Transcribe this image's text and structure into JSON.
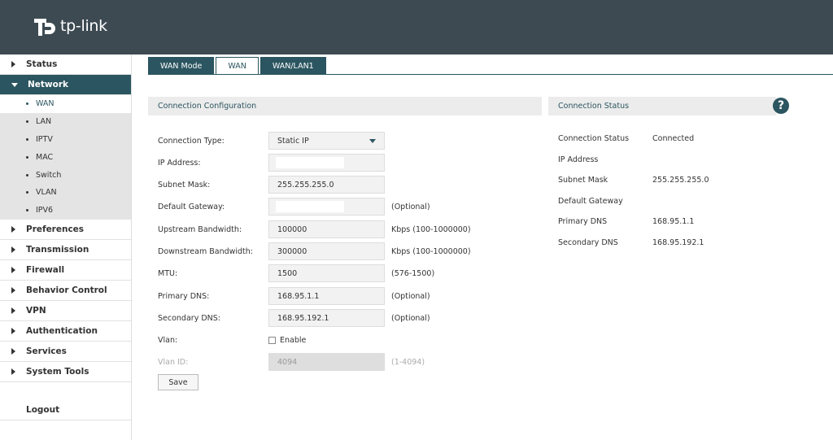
{
  "brand": {
    "name": "tp-link"
  },
  "colors": {
    "header": "#3d4a52",
    "accent": "#2b5560",
    "panel_head": "#ececec"
  },
  "sidebar": {
    "items": [
      {
        "label": "Status"
      },
      {
        "label": "Network",
        "active": true,
        "sub": [
          {
            "label": "WAN",
            "active": true
          },
          {
            "label": "LAN"
          },
          {
            "label": "IPTV"
          },
          {
            "label": "MAC"
          },
          {
            "label": "Switch"
          },
          {
            "label": "VLAN"
          },
          {
            "label": "IPV6"
          }
        ]
      },
      {
        "label": "Preferences"
      },
      {
        "label": "Transmission"
      },
      {
        "label": "Firewall"
      },
      {
        "label": "Behavior Control"
      },
      {
        "label": "VPN"
      },
      {
        "label": "Authentication"
      },
      {
        "label": "Services"
      },
      {
        "label": "System Tools"
      }
    ],
    "logout": "Logout"
  },
  "tabs": [
    {
      "label": "WAN Mode"
    },
    {
      "label": "WAN",
      "active": true
    },
    {
      "label": "WAN/LAN1"
    }
  ],
  "config": {
    "title": "Connection Configuration",
    "connection_type": {
      "label": "Connection Type:",
      "value": "Static IP"
    },
    "ip_address": {
      "label": "IP Address:",
      "value": ""
    },
    "subnet_mask": {
      "label": "Subnet Mask:",
      "value": "255.255.255.0"
    },
    "default_gateway": {
      "label": "Default Gateway:",
      "value": "",
      "hint": "(Optional)"
    },
    "upstream": {
      "label": "Upstream Bandwidth:",
      "value": "100000",
      "hint": "Kbps (100-1000000)"
    },
    "downstream": {
      "label": "Downstream Bandwidth:",
      "value": "300000",
      "hint": "Kbps (100-1000000)"
    },
    "mtu": {
      "label": "MTU:",
      "value": "1500",
      "hint": "(576-1500)"
    },
    "primary_dns": {
      "label": "Primary DNS:",
      "value": "168.95.1.1",
      "hint": "(Optional)"
    },
    "secondary_dns": {
      "label": "Secondary DNS:",
      "value": "168.95.192.1",
      "hint": "(Optional)"
    },
    "vlan": {
      "label": "Vlan:",
      "checkbox_label": "Enable",
      "checked": false
    },
    "vlan_id": {
      "label": "Vlan ID:",
      "value": "4094",
      "hint": "(1-4094)"
    },
    "save_label": "Save"
  },
  "status": {
    "title": "Connection Status",
    "rows": [
      {
        "key": "Connection Status",
        "value": "Connected"
      },
      {
        "key": "IP Address",
        "value": ""
      },
      {
        "key": "Subnet Mask",
        "value": "255.255.255.0"
      },
      {
        "key": "Default Gateway",
        "value": ""
      },
      {
        "key": "Primary DNS",
        "value": "168.95.1.1"
      },
      {
        "key": "Secondary DNS",
        "value": "168.95.192.1"
      }
    ]
  },
  "help": {
    "icon": "question-icon",
    "glyph": "?"
  }
}
